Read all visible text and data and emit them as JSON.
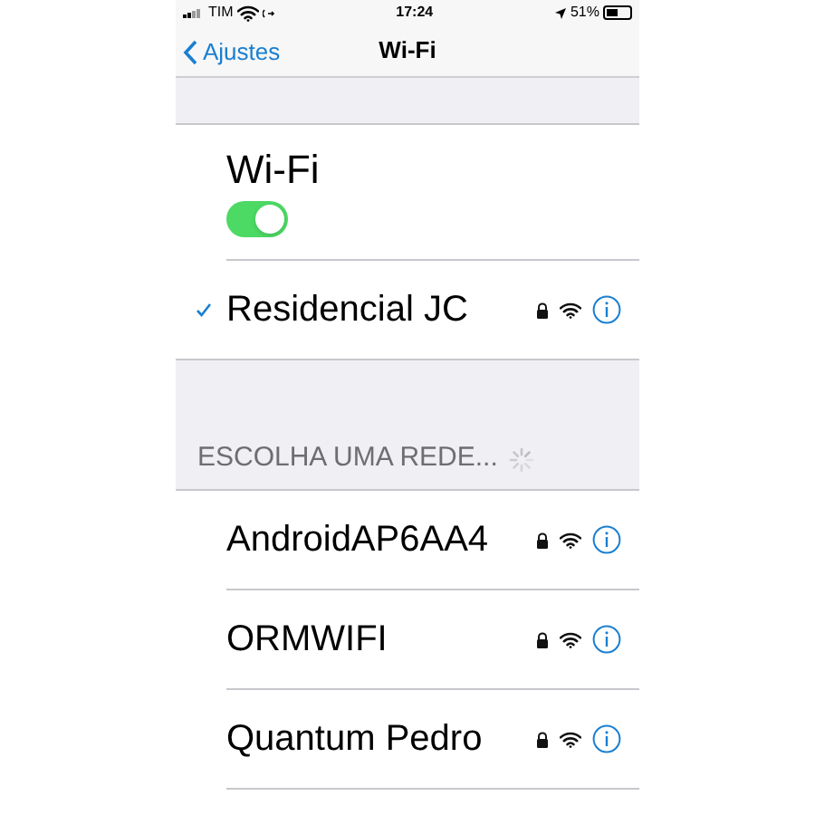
{
  "status_bar": {
    "carrier": "TIM",
    "time": "17:24",
    "battery": "51%"
  },
  "nav_bar": {
    "back": "Ajustes",
    "title": "Wi-Fi"
  },
  "wifi": {
    "label": "Wi-Fi",
    "on": true
  },
  "current_network": {
    "name": "Residencial JC",
    "checked": true,
    "locked": true
  },
  "section_header": "ESCOLHA UMA REDE...",
  "networks": [
    {
      "name": "AndroidAP6AA4",
      "locked": true
    },
    {
      "name": "ORMWIFI",
      "locked": true
    },
    {
      "name": "Quantum Pedro",
      "locked": true
    }
  ]
}
